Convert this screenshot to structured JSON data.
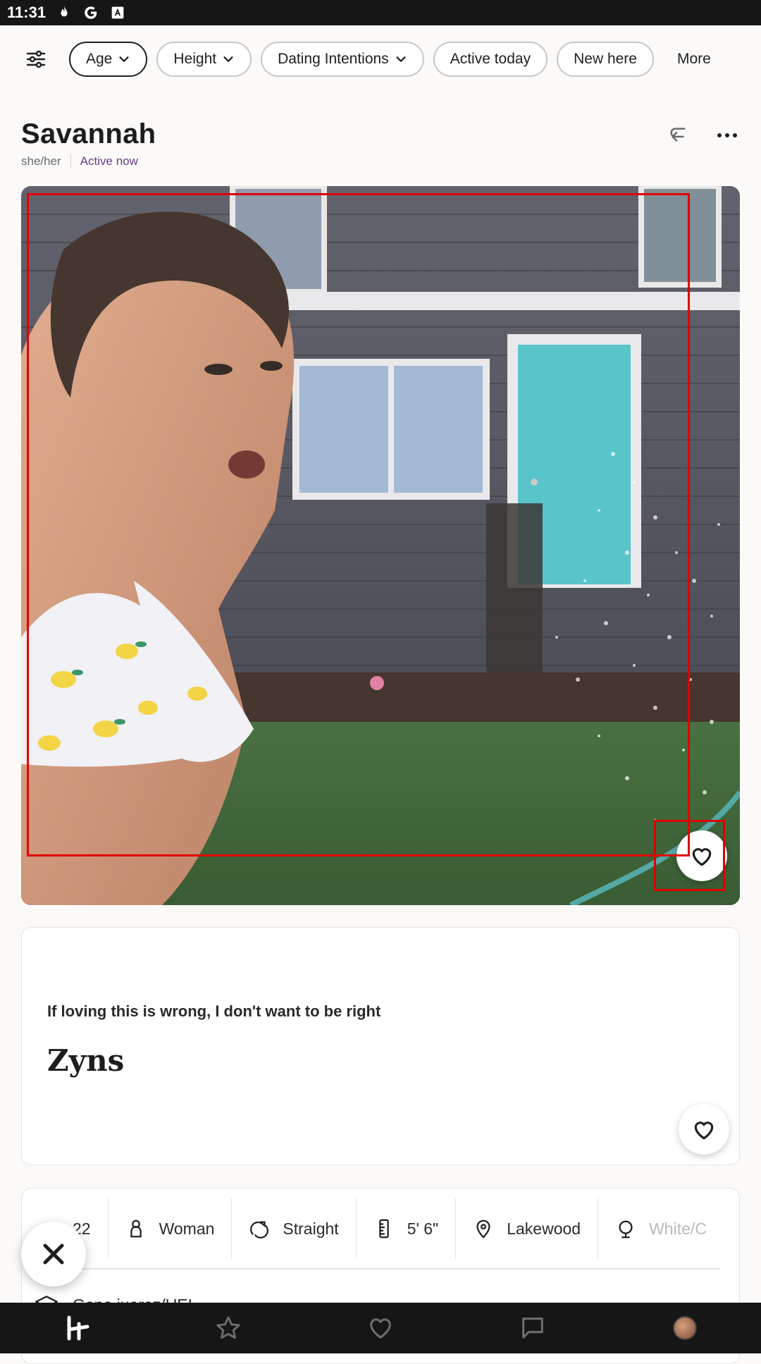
{
  "status_bar": {
    "time": "11:31",
    "icons": [
      "flame-icon",
      "google-icon",
      "a-icon"
    ]
  },
  "filters": {
    "icon": "sliders-icon",
    "chips": [
      {
        "label": "Age",
        "dropdown": true,
        "active": true
      },
      {
        "label": "Height",
        "dropdown": true,
        "active": false
      },
      {
        "label": "Dating Intentions",
        "dropdown": true,
        "active": false
      },
      {
        "label": "Active today",
        "dropdown": false,
        "active": false
      },
      {
        "label": "New here",
        "dropdown": false,
        "active": false
      }
    ],
    "more_label": "More"
  },
  "profile": {
    "name": "Savannah",
    "pronouns": "she/her",
    "status": "Active now",
    "status_color": "#6b3b8a",
    "actions": [
      "undo-icon",
      "more-options-icon"
    ]
  },
  "photo": {
    "like_icon": "heart-icon"
  },
  "prompt": {
    "question": "If loving this is wrong, I don't want to be right",
    "answer": "Zyns",
    "like_icon": "heart-icon"
  },
  "vitals": [
    {
      "icon": "cake-icon",
      "value": "22"
    },
    {
      "icon": "person-icon",
      "value": "Woman"
    },
    {
      "icon": "orientation-icon",
      "value": "Straight"
    },
    {
      "icon": "ruler-icon",
      "value": "5' 6\""
    },
    {
      "icon": "location-pin-icon",
      "value": "Lakewood"
    },
    {
      "icon": "globe-icon",
      "value": "White/C"
    }
  ],
  "education": {
    "icon": "graduation-cap-icon",
    "value": "Gene juarez/UEI"
  },
  "dismiss": {
    "icon": "close-icon"
  },
  "nav": {
    "items": [
      "home-logo-icon",
      "standouts-star-icon",
      "likes-heart-icon",
      "messages-chat-icon",
      "profile-avatar"
    ],
    "active": "home-logo-icon"
  },
  "theme": {
    "background": "#fbfaf9",
    "bar": "#161616",
    "highlight": "#e10000"
  }
}
